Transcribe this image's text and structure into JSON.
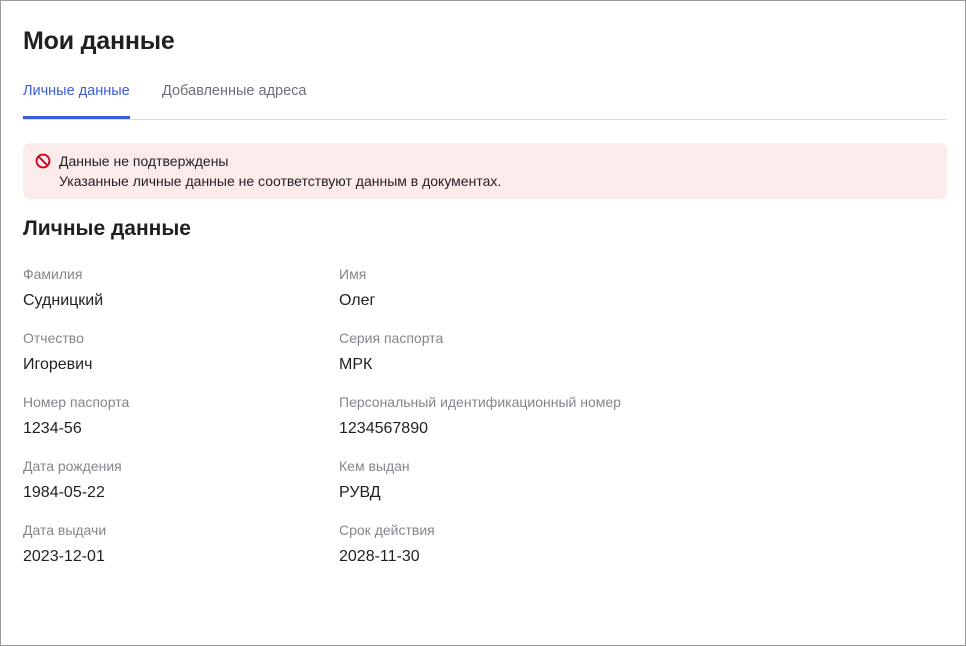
{
  "page": {
    "title": "Мои данные"
  },
  "tabs": [
    {
      "label": "Личные данные",
      "active": true
    },
    {
      "label": "Добавленные адреса",
      "active": false
    }
  ],
  "alert": {
    "icon": "prohibited-icon",
    "color": "#d0021b",
    "background": "#fcebeb",
    "title": "Данные не подтверждены",
    "text": "Указанные личные данные не соответствуют данным в документах."
  },
  "section": {
    "title": "Личные данные"
  },
  "fields": {
    "surname": {
      "label": "Фамилия",
      "value": "Судницкий"
    },
    "name": {
      "label": "Имя",
      "value": "Олег"
    },
    "patronymic": {
      "label": "Отчество",
      "value": "Игоревич"
    },
    "passport_series": {
      "label": "Серия паспорта",
      "value": "МРК"
    },
    "passport_number": {
      "label": "Номер паспорта",
      "value": "1234-56"
    },
    "personal_id": {
      "label": "Персональный идентификационный номер",
      "value": "1234567890"
    },
    "birth_date": {
      "label": "Дата рождения",
      "value": "1984-05-22"
    },
    "issued_by": {
      "label": "Кем выдан",
      "value": "РУВД"
    },
    "issue_date": {
      "label": "Дата выдачи",
      "value": "2023-12-01"
    },
    "expiry_date": {
      "label": "Срок действия",
      "value": "2028-11-30"
    }
  },
  "colors": {
    "accent": "#3c5bd8",
    "text": "#1f1f24",
    "muted": "#85858c"
  }
}
